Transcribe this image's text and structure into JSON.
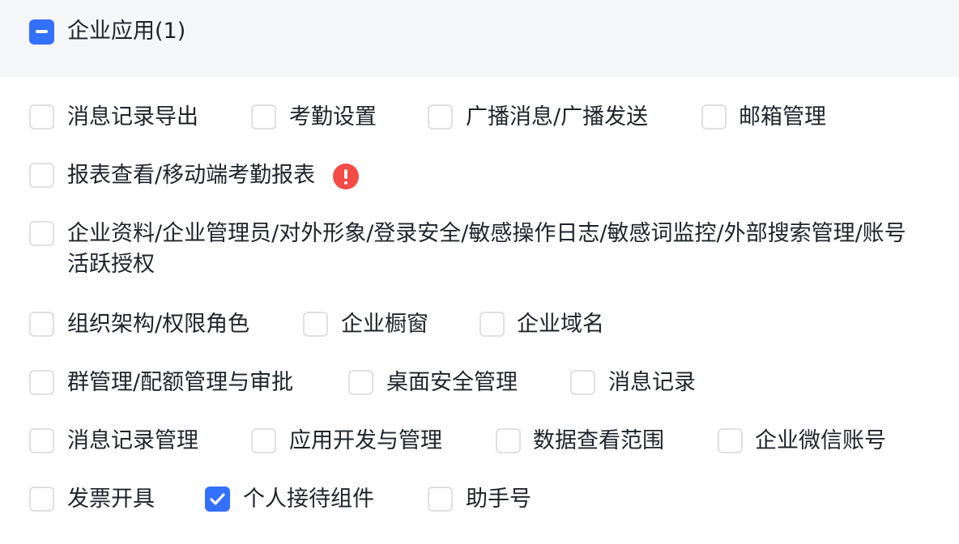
{
  "group": {
    "title": "企业应用(1)",
    "state": "indeterminate"
  },
  "permissions": [
    {
      "label": "消息记录导出",
      "checked": false
    },
    {
      "label": "考勤设置",
      "checked": false
    },
    {
      "label": "广播消息/广播发送",
      "checked": false
    },
    {
      "label": "邮箱管理",
      "checked": false
    },
    {
      "label": "报表查看/移动端考勤报表",
      "checked": false,
      "warning_icon": "exclamation-circle-icon"
    },
    {
      "label": "企业资料/企业管理员/对外形象/登录安全/敏感操作日志/敏感词监控/外部搜索管理/账号活跃授权",
      "checked": false
    },
    {
      "label": "组织架构/权限角色",
      "checked": false
    },
    {
      "label": "企业橱窗",
      "checked": false
    },
    {
      "label": "企业域名",
      "checked": false
    },
    {
      "label": "群管理/配额管理与审批",
      "checked": false
    },
    {
      "label": "桌面安全管理",
      "checked": false
    },
    {
      "label": "消息记录",
      "checked": false
    },
    {
      "label": "消息记录管理",
      "checked": false
    },
    {
      "label": "应用开发与管理",
      "checked": false
    },
    {
      "label": "数据查看范围",
      "checked": false
    },
    {
      "label": "企业微信账号",
      "checked": false
    },
    {
      "label": "发票开具",
      "checked": false
    },
    {
      "label": "个人接待组件",
      "checked": true
    },
    {
      "label": "助手号",
      "checked": false
    }
  ],
  "colors": {
    "accent": "#3370ff",
    "warning": "#f54a45",
    "header_bg": "#f5f6f7",
    "checkbox_border": "#dee0e3",
    "text": "#1f2329"
  }
}
